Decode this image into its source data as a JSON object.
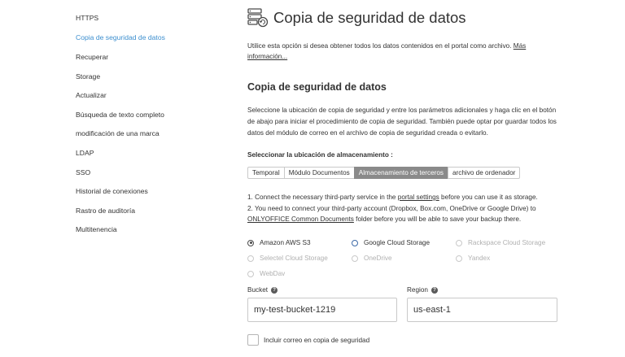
{
  "sidebar": {
    "items": [
      {
        "label": "HTTPS",
        "active": false
      },
      {
        "label": "Copia de seguridad de datos",
        "active": true
      },
      {
        "label": "Recuperar",
        "active": false
      },
      {
        "label": "Storage",
        "active": false
      },
      {
        "label": "Actualizar",
        "active": false
      },
      {
        "label": "Búsqueda de texto completo",
        "active": false
      },
      {
        "label": "modificación de una marca",
        "active": false
      },
      {
        "label": "LDAP",
        "active": false
      },
      {
        "label": "SSO",
        "active": false
      },
      {
        "label": "Historial de conexiones",
        "active": false
      },
      {
        "label": "Rastro de auditoría",
        "active": false
      },
      {
        "label": "Multitenencia",
        "active": false
      }
    ]
  },
  "header": {
    "title": "Copia de seguridad de datos",
    "icon": "backup-icon"
  },
  "intro": {
    "text": "Utilice esta opción si desea obtener todos los datos contenidos en el portal como archivo. ",
    "link": "Más información..."
  },
  "section": {
    "title": "Copia de seguridad de datos",
    "description": "Seleccione la ubicación de copia de seguridad y entre los parámetros adicionales y haga clic en el botón de abajo para iniciar el procedimiento de copia de seguridad. También puede optar por guardar todos los datos del módulo de correo en el archivo de copia de seguridad creada o evitarlo."
  },
  "storage": {
    "label": "Seleccionar la ubicación de almacenamiento :",
    "tabs": [
      {
        "label": "Temporal",
        "active": false
      },
      {
        "label": "Módulo Documentos",
        "active": false
      },
      {
        "label": "Almacenamiento de terceros",
        "active": true
      },
      {
        "label": "archivo de ordenador",
        "active": false
      }
    ]
  },
  "notes": {
    "line1_prefix": "1. Connect the necessary third-party service in the ",
    "line1_link": "portal settings",
    "line1_suffix": " before you can use it as storage.",
    "line2_text": "2. You need to connect your third-party account (Dropbox, Box.com, OneDrive or Google Drive) to ",
    "line2_link": "ONLYOFFICE Common Documents",
    "line2_suffix": " folder before you will be able to save your backup there."
  },
  "providers": [
    {
      "label": "Amazon AWS S3",
      "state": "checked"
    },
    {
      "label": "Google Cloud Storage",
      "state": "enabled"
    },
    {
      "label": "Rackspace Cloud Storage",
      "state": "disabled"
    },
    {
      "label": "Selectel Cloud Storage",
      "state": "disabled"
    },
    {
      "label": "OneDrive",
      "state": "disabled"
    },
    {
      "label": "Yandex",
      "state": "disabled"
    },
    {
      "label": "WebDav",
      "state": "disabled"
    }
  ],
  "fields": {
    "bucket_label": "Bucket",
    "bucket_value": "my-test-bucket-1219",
    "region_label": "Region",
    "region_value": "us-east-1",
    "help_glyph": "?"
  },
  "mail_checkbox": {
    "label": "Incluir correo en copia de seguridad",
    "checked": false
  },
  "colors": {
    "accent": "#3d8fcf",
    "active_tab": "#8a8a8a"
  }
}
